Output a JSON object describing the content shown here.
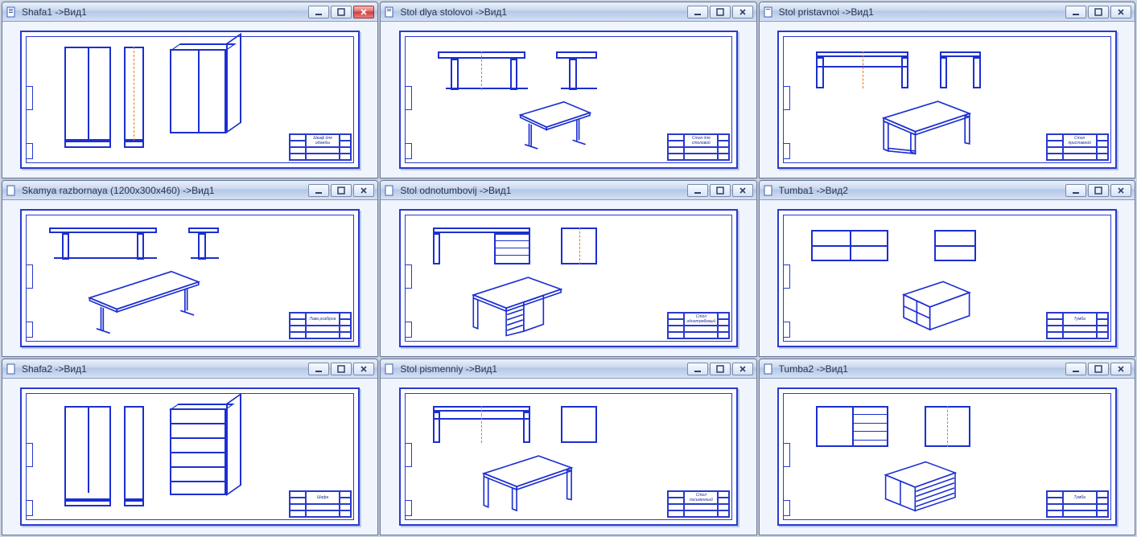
{
  "windows": [
    {
      "title": "Shafa1 ->Вид1",
      "block_label": "Шкаф для одежды",
      "active_close": true
    },
    {
      "title": "Stol dlya stolovoi ->Вид1",
      "block_label": "Стол для столовой",
      "active_close": false
    },
    {
      "title": "Stol pristavnoi ->Вид1",
      "block_label": "Стол приставной",
      "active_close": false
    },
    {
      "title": "Skamya razbornaya (1200x300x460) ->Вид1",
      "block_label": "Лава розбірна",
      "active_close": false
    },
    {
      "title": "Stol odnotumbovij ->Вид1",
      "block_label": "Стол однотумбовый",
      "active_close": false
    },
    {
      "title": "Tumba1 ->Вид2",
      "block_label": "Тумба",
      "active_close": false
    },
    {
      "title": "Shafa2 ->Вид1",
      "block_label": "Шафа",
      "active_close": false
    },
    {
      "title": "Stol pismenniy ->Вид1",
      "block_label": "Стол письменный",
      "active_close": false
    },
    {
      "title": "Tumba2 ->Вид1",
      "block_label": "Тумба",
      "active_close": false
    }
  ],
  "icon_names": {
    "document": "document-icon",
    "minimize": "minimize-icon",
    "maximize": "maximize-icon",
    "close": "close-icon"
  }
}
